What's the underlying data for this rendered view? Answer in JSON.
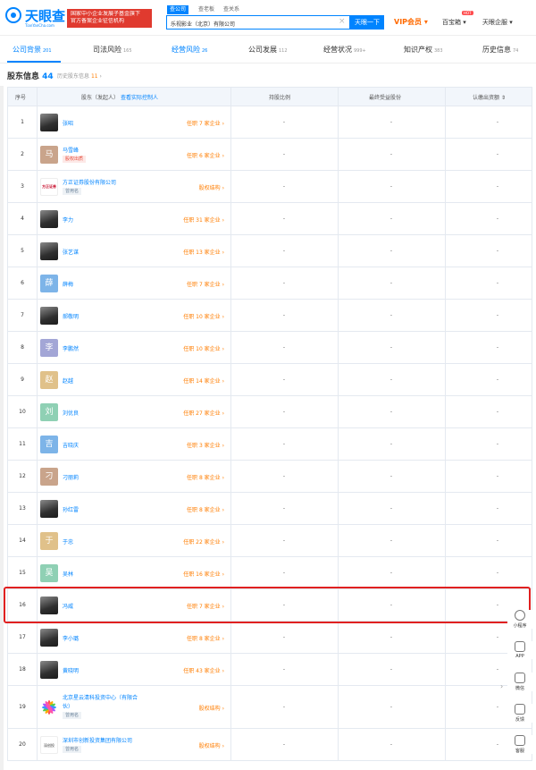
{
  "header": {
    "logo_text": "天眼查",
    "logo_sub": "TianYanCha.com",
    "banner_line1": "国家中小企业发展子基金旗下",
    "banner_line2": "官方备案企业征信机构",
    "search_tabs": [
      "查公司",
      "查老板",
      "查关系"
    ],
    "search_value": "乐视影业（北京）有限公司",
    "search_button": "天眼一下",
    "vip": "VIP会员",
    "baobao": "百宝箱",
    "hot": "HOT",
    "enterprise": "天眼企服"
  },
  "tabs": [
    {
      "label": "公司背景",
      "count": "201"
    },
    {
      "label": "司法风险",
      "count": "165"
    },
    {
      "label": "经营风险",
      "count": "26"
    },
    {
      "label": "公司发展",
      "count": "112"
    },
    {
      "label": "经营状况",
      "count": "999+"
    },
    {
      "label": "知识产权",
      "count": "383"
    },
    {
      "label": "历史信息",
      "count": "74"
    }
  ],
  "section": {
    "title": "股东信息",
    "count": "44",
    "history_label": "历史股东信息",
    "history_count": "11"
  },
  "table": {
    "col_index": "序号",
    "col_holder": "股东（发起人）",
    "col_holder_link": "查看实际控制人",
    "col_ratio": "持股比例",
    "col_final": "最终受益股份",
    "col_capital": "认缴出资额",
    "rows": [
      {
        "idx": "1",
        "name": "张昭",
        "avatar": "",
        "pos": "任职 7 家企业",
        "ratio": "-",
        "final": "-",
        "capital": "-"
      },
      {
        "idx": "2",
        "name": "马雪峰",
        "avatar": "马",
        "tag": "股权出质",
        "pos": "任职 6 家企业",
        "ratio": "-",
        "final": "-",
        "capital": "-"
      },
      {
        "idx": "3",
        "name": "方正证券股份有限公司",
        "avatar": "方正证券",
        "tag": "曾用名",
        "pos": "股权结构",
        "ratio": "-",
        "final": "-",
        "capital": "-"
      },
      {
        "idx": "4",
        "name": "李力",
        "avatar": "",
        "pos": "任职 31 家企业",
        "ratio": "-",
        "final": "-",
        "capital": "-"
      },
      {
        "idx": "5",
        "name": "张艺谋",
        "avatar": "",
        "pos": "任职 13 家企业",
        "ratio": "-",
        "final": "-",
        "capital": "-"
      },
      {
        "idx": "6",
        "name": "薛梅",
        "avatar": "薛",
        "pos": "任职 7 家企业",
        "ratio": "-",
        "final": "-",
        "capital": "-"
      },
      {
        "idx": "7",
        "name": "郝敬明",
        "avatar": "",
        "pos": "任职 10 家企业",
        "ratio": "-",
        "final": "-",
        "capital": "-"
      },
      {
        "idx": "8",
        "name": "李鹏然",
        "avatar": "李",
        "pos": "任职 10 家企业",
        "ratio": "-",
        "final": "-",
        "capital": "-"
      },
      {
        "idx": "9",
        "name": "赵越",
        "avatar": "赵",
        "pos": "任职 14 家企业",
        "ratio": "-",
        "final": "-",
        "capital": "-"
      },
      {
        "idx": "10",
        "name": "刘优良",
        "avatar": "刘",
        "pos": "任职 27 家企业",
        "ratio": "-",
        "final": "-",
        "capital": "-"
      },
      {
        "idx": "11",
        "name": "吉晓庆",
        "avatar": "吉",
        "pos": "任职 3 家企业",
        "ratio": "-",
        "final": "-",
        "capital": "-"
      },
      {
        "idx": "12",
        "name": "刁丽莉",
        "avatar": "刁",
        "pos": "任职 8 家企业",
        "ratio": "-",
        "final": "-",
        "capital": "-"
      },
      {
        "idx": "13",
        "name": "孙红雷",
        "avatar": "",
        "pos": "任职 8 家企业",
        "ratio": "-",
        "final": "-",
        "capital": "-"
      },
      {
        "idx": "14",
        "name": "于忠",
        "avatar": "于",
        "pos": "任职 22 家企业",
        "ratio": "-",
        "final": "-",
        "capital": "-"
      },
      {
        "idx": "15",
        "name": "吴林",
        "avatar": "吴",
        "pos": "任职 16 家企业",
        "ratio": "-",
        "final": "-",
        "capital": "-"
      },
      {
        "idx": "16",
        "name": "冯威",
        "avatar": "",
        "pos": "任职 7 家企业",
        "ratio": "-",
        "final": "-",
        "capital": "-"
      },
      {
        "idx": "17",
        "name": "李小璐",
        "avatar": "",
        "pos": "任职 8 家企业",
        "ratio": "-",
        "final": "-",
        "capital": "-"
      },
      {
        "idx": "18",
        "name": "黄晓明",
        "avatar": "",
        "pos": "任职 43 家企业",
        "ratio": "-",
        "final": "-",
        "capital": "-"
      },
      {
        "idx": "19",
        "name": "北京星云清科投资中心（有限合",
        "name2": "伙）",
        "avatar": "",
        "tag": "曾用名",
        "pos": "股权结构",
        "ratio": "-",
        "final": "-",
        "capital": "-"
      },
      {
        "idx": "20",
        "name": "深圳市创新投资集团有限公司",
        "avatar": "深创投",
        "tag": "曾用名",
        "pos": "股权结构",
        "ratio": "-",
        "final": "-",
        "capital": "-"
      }
    ]
  },
  "float_bar": [
    {
      "label": "小程序",
      "icon": "mini-program-icon"
    },
    {
      "label": "APP",
      "icon": "phone-icon"
    },
    {
      "label": "微信",
      "icon": "qrcode-icon"
    },
    {
      "label": "反馈",
      "icon": "feedback-icon"
    },
    {
      "label": "客服",
      "icon": "service-icon"
    }
  ],
  "colors": {
    "brand": "#0084ff",
    "orange": "#ff7d00",
    "highlight": "#e02020",
    "avatar_palette": [
      "#7db4e8",
      "#c9a48b",
      "#a3a6d6",
      "#e0c18a",
      "#8fd0b4"
    ]
  }
}
